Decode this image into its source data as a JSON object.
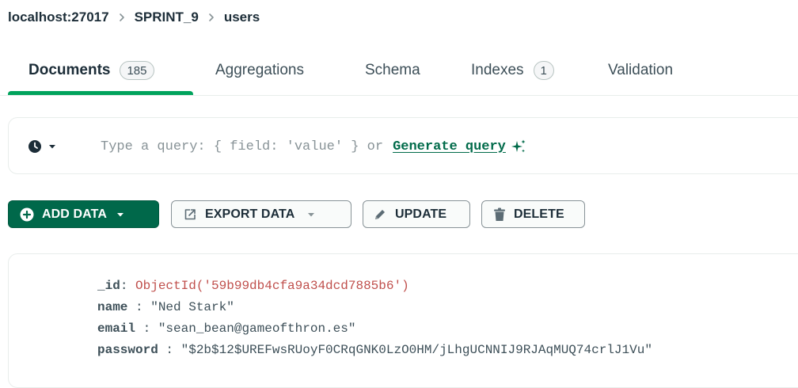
{
  "breadcrumb": {
    "host": "localhost:27017",
    "database": "SPRINT_9",
    "collection": "users"
  },
  "tabs": [
    {
      "label": "Documents",
      "badge": "185",
      "active": true
    },
    {
      "label": "Aggregations",
      "badge": null,
      "active": false
    },
    {
      "label": "Schema",
      "badge": null,
      "active": false
    },
    {
      "label": "Indexes",
      "badge": "1",
      "active": false
    },
    {
      "label": "Validation",
      "badge": null,
      "active": false
    }
  ],
  "query": {
    "placeholder": "Type a query: { field: 'value' } or",
    "generate_label": "Generate query"
  },
  "toolbar": {
    "add_data": "ADD DATA",
    "export_data": "EXPORT DATA",
    "update": "UPDATE",
    "delete": "DELETE"
  },
  "document": {
    "fields": [
      {
        "key": "_id",
        "value": "ObjectId('59b99db4cfa9a34dcd7885b6')",
        "type": "objectid"
      },
      {
        "key": "name",
        "value": "\"Ned Stark\"",
        "type": "string"
      },
      {
        "key": "email",
        "value": "\"sean_bean@gameofthron.es\"",
        "type": "string"
      },
      {
        "key": "password",
        "value": "\"$2b$12$UREFwsRUoyF0CRqGNK0LzO0HM/jLhgUCNNIJ9RJAqMUQ74crlJ1Vu\"",
        "type": "string"
      }
    ]
  },
  "colors": {
    "accent_green": "#00a35c",
    "button_green": "#00684a",
    "link_green": "#016b4a",
    "objectid_red": "#c0504d"
  },
  "icons": {
    "history": "clock-icon",
    "generate": "sparkle-icon",
    "add": "plus-circle-icon",
    "export": "export-icon",
    "update": "pencil-icon",
    "delete": "trash-icon"
  }
}
